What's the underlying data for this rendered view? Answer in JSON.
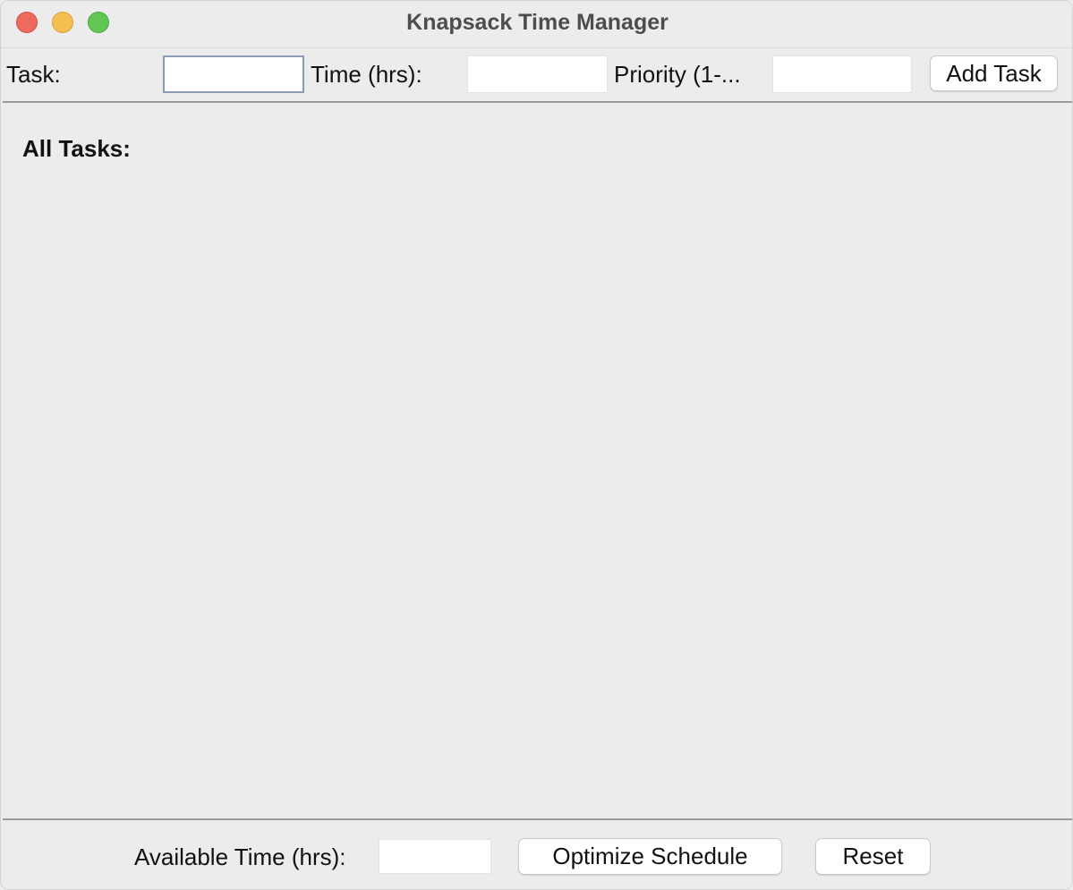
{
  "window": {
    "title": "Knapsack Time Manager"
  },
  "input_bar": {
    "task_label": "Task:",
    "task_value": "",
    "time_label": "Time (hrs):",
    "time_value": "",
    "priority_label": "Priority (1-...",
    "priority_value": "",
    "add_button": "Add Task"
  },
  "main": {
    "heading": "All Tasks:"
  },
  "footer": {
    "available_label": "Available Time (hrs):",
    "available_value": "",
    "optimize_button": "Optimize Schedule",
    "reset_button": "Reset"
  }
}
